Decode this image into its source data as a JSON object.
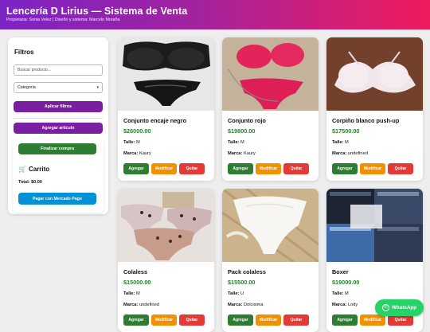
{
  "header": {
    "title": "Lencería D Lirius — Sistema de Venta",
    "subtitle": "Propietaria: Sonia Velez | Diseño y sistema: Marcelo Moraña"
  },
  "sidebar": {
    "title": "Filtros",
    "search_placeholder": "Buscar producto...",
    "category_selected": "Categoría",
    "apply_label": "Aplicar filtros",
    "add_label": "Agregar artículo"
  },
  "cart": {
    "checkout_label": "Finalizar compra",
    "title": "Carrito",
    "total": "Total: $0.00",
    "pay_label": "Pagar con Mercado Pago"
  },
  "labels": {
    "talle": "Talle:",
    "marca": "Marca:",
    "agregar": "Agregar",
    "modificar": "Modificar",
    "quitar": "Quitar"
  },
  "products": [
    {
      "name": "Conjunto encaje negro",
      "price": "$26000.00",
      "talle": "M",
      "marca": "Kaury"
    },
    {
      "name": "Conjunto rojo",
      "price": "$19800.00",
      "talle": "M",
      "marca": "Kaury"
    },
    {
      "name": "Corpiño blanco push-up",
      "price": "$17500.00",
      "talle": "M",
      "marca": "undefined"
    },
    {
      "name": "Colaless",
      "price": "$15000.00",
      "talle": "M",
      "marca": "undefined"
    },
    {
      "name": "Pack colaless",
      "price": "$15500.00",
      "talle": "U",
      "marca": "Dolcisima"
    },
    {
      "name": "Boxer",
      "price": "$19000.00",
      "talle": "M",
      "marca": "Lody"
    }
  ],
  "whatsapp": {
    "label": "WhatsApp",
    "icon": "whatsapp-icon"
  },
  "colors": {
    "header_gradient": [
      "#7b24c4",
      "#ee1b5e"
    ],
    "purple": "#7b1fa2",
    "green": "#2e7d32",
    "orange": "#f29100",
    "red": "#e53935",
    "blue": "#0091d6",
    "whatsapp": "#25d366"
  }
}
